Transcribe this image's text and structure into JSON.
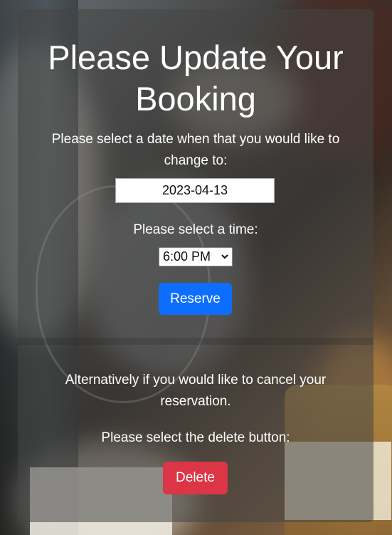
{
  "page": {
    "title": "Please Update Your Booking",
    "date_prompt": "Please select a date when that you would like to change to:",
    "date_value": "2023-04-13",
    "time_prompt": "Please select a time:",
    "time_selected": "6:00 PM",
    "reserve_label": "Reserve",
    "cancel_text": "Alternatively if you would like to cancel your reservation.",
    "delete_prompt": "Please select the delete button:",
    "delete_label": "Delete"
  },
  "colors": {
    "reserve_button": "#0d6efd",
    "delete_button": "#dc3545",
    "card_overlay": "rgba(70,70,70,0.55)"
  },
  "icons": {
    "time_dropdown": "chevron-down-icon"
  }
}
